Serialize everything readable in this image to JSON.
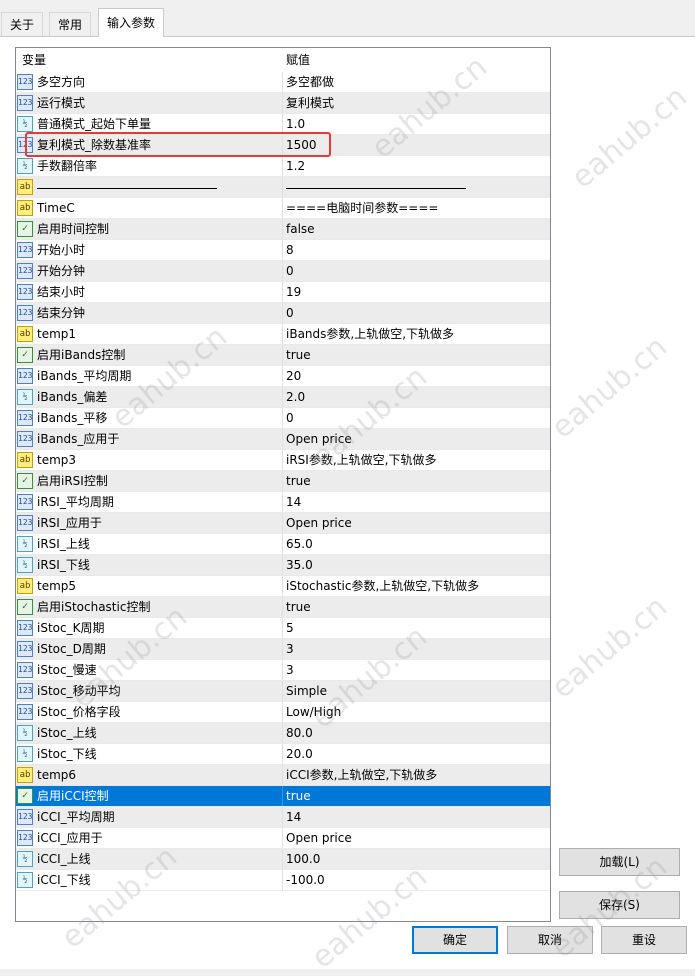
{
  "tabs": [
    {
      "label": "关于",
      "active": false
    },
    {
      "label": "常用",
      "active": false
    },
    {
      "label": "输入参数",
      "active": true
    }
  ],
  "grid": {
    "headers": {
      "variable": "变量",
      "value": "赋值"
    },
    "rows": [
      {
        "icon": "123",
        "name": "多空方向",
        "value": "多空都做"
      },
      {
        "icon": "123",
        "name": "运行模式",
        "value": "复利模式"
      },
      {
        "icon": "1/2",
        "name": "普通模式_起始下单量",
        "value": "1.0"
      },
      {
        "icon": "123",
        "name": "复利模式_除数基准率",
        "value": "1500"
      },
      {
        "icon": "1/2",
        "name": "手数翻倍率",
        "value": "1.2"
      },
      {
        "icon": "ab",
        "name": "",
        "value": "",
        "separator": true
      },
      {
        "icon": "ab",
        "name": "TimeC",
        "value": "====电脑时间参数===="
      },
      {
        "icon": "bool",
        "name": "启用时间控制",
        "value": "false"
      },
      {
        "icon": "123",
        "name": "开始小时",
        "value": "8"
      },
      {
        "icon": "123",
        "name": "开始分钟",
        "value": "0"
      },
      {
        "icon": "123",
        "name": "结束小时",
        "value": "19"
      },
      {
        "icon": "123",
        "name": "结束分钟",
        "value": "0"
      },
      {
        "icon": "ab",
        "name": "temp1",
        "value": "iBands参数,上轨做空,下轨做多"
      },
      {
        "icon": "bool",
        "name": "启用iBands控制",
        "value": "true"
      },
      {
        "icon": "123",
        "name": "iBands_平均周期",
        "value": "20"
      },
      {
        "icon": "1/2",
        "name": "iBands_偏差",
        "value": "2.0"
      },
      {
        "icon": "123",
        "name": "iBands_平移",
        "value": "0"
      },
      {
        "icon": "123",
        "name": "iBands_应用于",
        "value": "Open price"
      },
      {
        "icon": "ab",
        "name": "temp3",
        "value": "iRSI参数,上轨做空,下轨做多"
      },
      {
        "icon": "bool",
        "name": "启用iRSI控制",
        "value": "true"
      },
      {
        "icon": "123",
        "name": "iRSI_平均周期",
        "value": "14"
      },
      {
        "icon": "123",
        "name": "iRSI_应用于",
        "value": "Open price"
      },
      {
        "icon": "1/2",
        "name": "iRSI_上线",
        "value": "65.0"
      },
      {
        "icon": "1/2",
        "name": "iRSI_下线",
        "value": "35.0"
      },
      {
        "icon": "ab",
        "name": "temp5",
        "value": "iStochastic参数,上轨做空,下轨做多"
      },
      {
        "icon": "bool",
        "name": "启用iStochastic控制",
        "value": "true"
      },
      {
        "icon": "123",
        "name": "iStoc_K周期",
        "value": "5"
      },
      {
        "icon": "123",
        "name": "iStoc_D周期",
        "value": "3"
      },
      {
        "icon": "123",
        "name": "iStoc_慢速",
        "value": "3"
      },
      {
        "icon": "123",
        "name": "iStoc_移动平均",
        "value": "Simple"
      },
      {
        "icon": "123",
        "name": "iStoc_价格字段",
        "value": "Low/High"
      },
      {
        "icon": "1/2",
        "name": "iStoc_上线",
        "value": "80.0"
      },
      {
        "icon": "1/2",
        "name": "iStoc_下线",
        "value": "20.0"
      },
      {
        "icon": "ab",
        "name": "temp6",
        "value": "iCCI参数,上轨做空,下轨做多"
      },
      {
        "icon": "bool",
        "name": "启用iCCI控制",
        "value": "true",
        "selected": true
      },
      {
        "icon": "123",
        "name": "iCCI_平均周期",
        "value": "14"
      },
      {
        "icon": "123",
        "name": "iCCI_应用于",
        "value": "Open price"
      },
      {
        "icon": "1/2",
        "name": "iCCI_上线",
        "value": "100.0"
      },
      {
        "icon": "1/2",
        "name": "iCCI_下线",
        "value": "-100.0"
      }
    ]
  },
  "side_buttons": {
    "load": "加载(L)",
    "save": "保存(S)"
  },
  "footer_buttons": {
    "ok": "确定",
    "cancel": "取消",
    "reset": "重设"
  },
  "watermark": "eahub.cn",
  "colors": {
    "selection": "#0078d7",
    "highlight_box": "#e53a3a"
  }
}
